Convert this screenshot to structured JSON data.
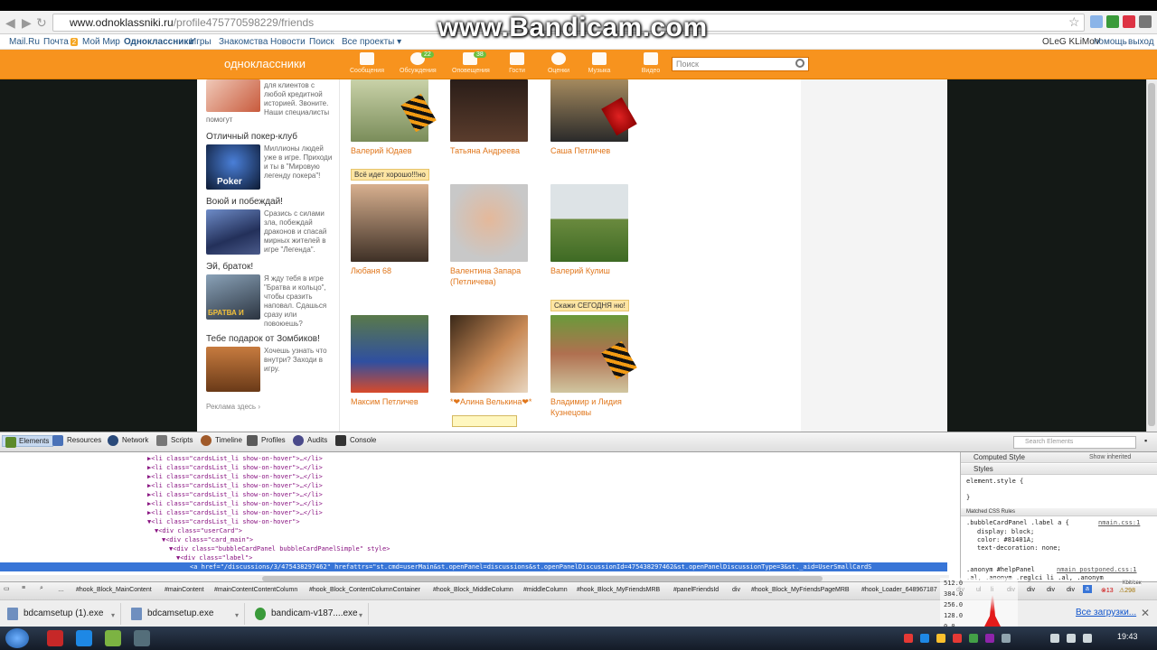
{
  "browser": {
    "url_host": "www.odnoklassniki.ru",
    "url_path": "/profile475770598229/friends",
    "watermark": "www.Bandicam.com"
  },
  "mailru_bar": {
    "links": [
      "Mail.Ru",
      "Почта",
      "Мой Мир",
      "Одноклассники",
      "Игры",
      "Знакомства",
      "Новости",
      "Поиск",
      "Все проекты ▾"
    ],
    "mail_badge": "2",
    "user": "OLeG KLiMoV",
    "help": "помощь",
    "logout": "выход"
  },
  "header": {
    "logo": "однoклассники",
    "items": [
      {
        "label": "Сообщения",
        "count": ""
      },
      {
        "label": "Обсуждения",
        "count": "22"
      },
      {
        "label": "Оповещения",
        "count": "38"
      },
      {
        "label": "Гости",
        "count": ""
      },
      {
        "label": "Оценки",
        "count": ""
      },
      {
        "label": "Музыка",
        "count": ""
      },
      {
        "label": "Видео",
        "count": ""
      }
    ],
    "search_placeholder": "Поиск"
  },
  "ads": {
    "items": [
      {
        "title": "",
        "text": "для клиентов с любой кредитной историей. Звоните. Наши специалисты",
        "tail": "помогут"
      },
      {
        "title": "Отличный покер-клуб",
        "text": "Миллионы людей уже в игре. Приходи и ты в \"Мировую легенду покера\"!"
      },
      {
        "title": "Воюй и побеждай!",
        "text": "Сразись с силами зла, побеждай драконов и спасай мирных жителей в игре \"Легенда\"."
      },
      {
        "title": "Эй, браток!",
        "text": "Я жду тебя в игре \"Братва и кольцо\", чтобы сразить наповал. Сдашься сразу или повоюешь?"
      },
      {
        "title": "Тебе подарок от Зомбиков!",
        "text": "Хочешь узнать что внутри? Заходи в игру."
      }
    ],
    "thumb_labels": [
      "Poker",
      "БРАТВА И"
    ],
    "footer": "Реклама здесь ›"
  },
  "friends": {
    "items": [
      {
        "name": "Валерий Юдаев",
        "status": ""
      },
      {
        "name": "Татьяна Андреева",
        "status": ""
      },
      {
        "name": "Саша Петличев",
        "status": ""
      },
      {
        "name": "Любаня 68",
        "status": "Всё идет хорошо!!!но"
      },
      {
        "name": "Валентина Запара (Петличева)",
        "status": ""
      },
      {
        "name": "Валерий Кулиш",
        "status": ""
      },
      {
        "name": "Максим Петличев",
        "status": ""
      },
      {
        "name": "*❤Алина Велькина❤*",
        "status": ""
      },
      {
        "name": "Владимир и Лидия Кузнецовы",
        "status": "Скажи СЕГОДНЯ ню!"
      }
    ]
  },
  "devtools": {
    "tabs": [
      "Elements",
      "Resources",
      "Network",
      "Scripts",
      "Timeline",
      "Profiles",
      "Audits",
      "Console"
    ],
    "active_tab": "Elements",
    "search_placeholder": "Search Elements",
    "dom_lines": [
      "▶<li class=\"cardsList_li show-on-hover\">…</li>",
      "▶<li class=\"cardsList_li show-on-hover\">…</li>",
      "▶<li class=\"cardsList_li show-on-hover\">…</li>",
      "▶<li class=\"cardsList_li show-on-hover\">…</li>",
      "▶<li class=\"cardsList_li show-on-hover\">…</li>",
      "▶<li class=\"cardsList_li show-on-hover\">…</li>",
      "▶<li class=\"cardsList_li show-on-hover\">…</li>",
      "▼<li class=\"cardsList_li show-on-hover\">",
      "▼<div class=\"userCard\">",
      "▼<div class=\"card_main\">",
      "▼<div class=\"bubbleCardPanel bubbleCardPanelSimple\" style>",
      "▼<div class=\"label\">",
      "<a href=\"/discussions/3/475438297462\" hrefattrs=\"st.cmd=userMain&st.openPanel=discussions&st.openPanelDiscussionId=475438297462&st.openPanelDiscussionType=3&st._aid=UserSmallCardS"
    ],
    "styles": {
      "computed": "Computed Style",
      "show_inherited": "Show inherited",
      "styles_head": "Styles",
      "element_style": "element.style {\n\n}",
      "matched": "Matched CSS Rules",
      "rule1_selector": ".bubbleCardPanel .label a {",
      "rule1_src": "nmain.css:1",
      "rule1_props": [
        "display: block;",
        "color: #81401A;",
        "text-decoration: none;"
      ],
      "rule2_selector": ".anonym #helpPanel",
      "rule2_src": "nmain_postponed.css:1",
      "rule2_tail": ".al, .anonym .reglci li .al, .anonym"
    },
    "breadcrumbs": [
      "#hook_Block_MainContent",
      "#mainContent",
      "#mainContentContentColumn",
      "#hook_Block_ContentColumnContainer",
      "#hook_Block_MiddleColumn",
      "#middleColumn",
      "#hook_Block_MyFriendsMRB",
      "#panelFriendsId",
      "div",
      "#hook_Block_MyFriendsPageMRB",
      "#hook_Loader_648967187",
      "div",
      "ul",
      "li",
      "div",
      "div",
      "div",
      "a"
    ],
    "errors": "13",
    "warnings": "298",
    "right_label": "Кbit/сек"
  },
  "meter": {
    "values": [
      "512.0",
      "384.0",
      "256.0",
      "128.0",
      "0.0"
    ]
  },
  "downloads": {
    "items": [
      "bdcamsetup (1).exe",
      "bdcamsetup.exe",
      "bandicam-v187....exe"
    ],
    "all": "Все загрузки..."
  },
  "taskbar": {
    "time": "19:43"
  }
}
